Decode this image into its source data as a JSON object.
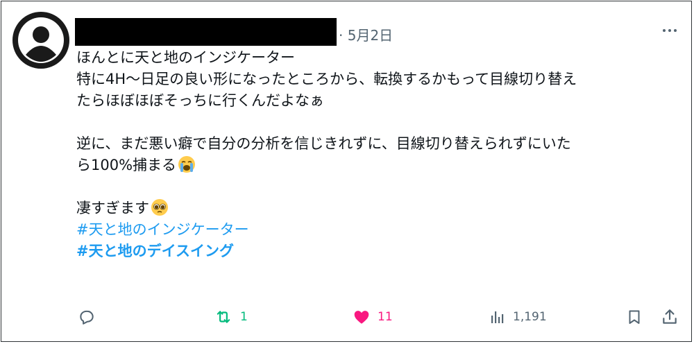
{
  "post": {
    "date_sep": "·",
    "date": "5月2日",
    "lines": [
      "ほんとに天と地のインジケーター",
      "特に4H～日足の良い形になったところから、転換するかもって目線切り替え",
      "たらほぼほぼそっちに行くんだよなぁ",
      "",
      "逆に、まだ悪い癖で自分の分析を信じきれずに、目線切り替えられずにいた",
      "ら100%捕まる",
      "",
      "凄すぎます"
    ],
    "hashtags": [
      "#天と地のインジケーター",
      "#天と地のデイスイング"
    ]
  },
  "actions": {
    "reply_count": "",
    "retweet_count": "1",
    "like_count": "11",
    "views_count": "1,191"
  },
  "colors": {
    "link": "#1d9bf0",
    "retweet": "#00ba7c",
    "like": "#f91880",
    "muted": "#536471"
  },
  "icons": [
    "avatar-placeholder",
    "more-dots-icon",
    "crying-emoji",
    "pleading-emoji",
    "reply-icon",
    "retweet-icon",
    "heart-icon",
    "views-icon",
    "bookmark-icon",
    "share-icon"
  ]
}
